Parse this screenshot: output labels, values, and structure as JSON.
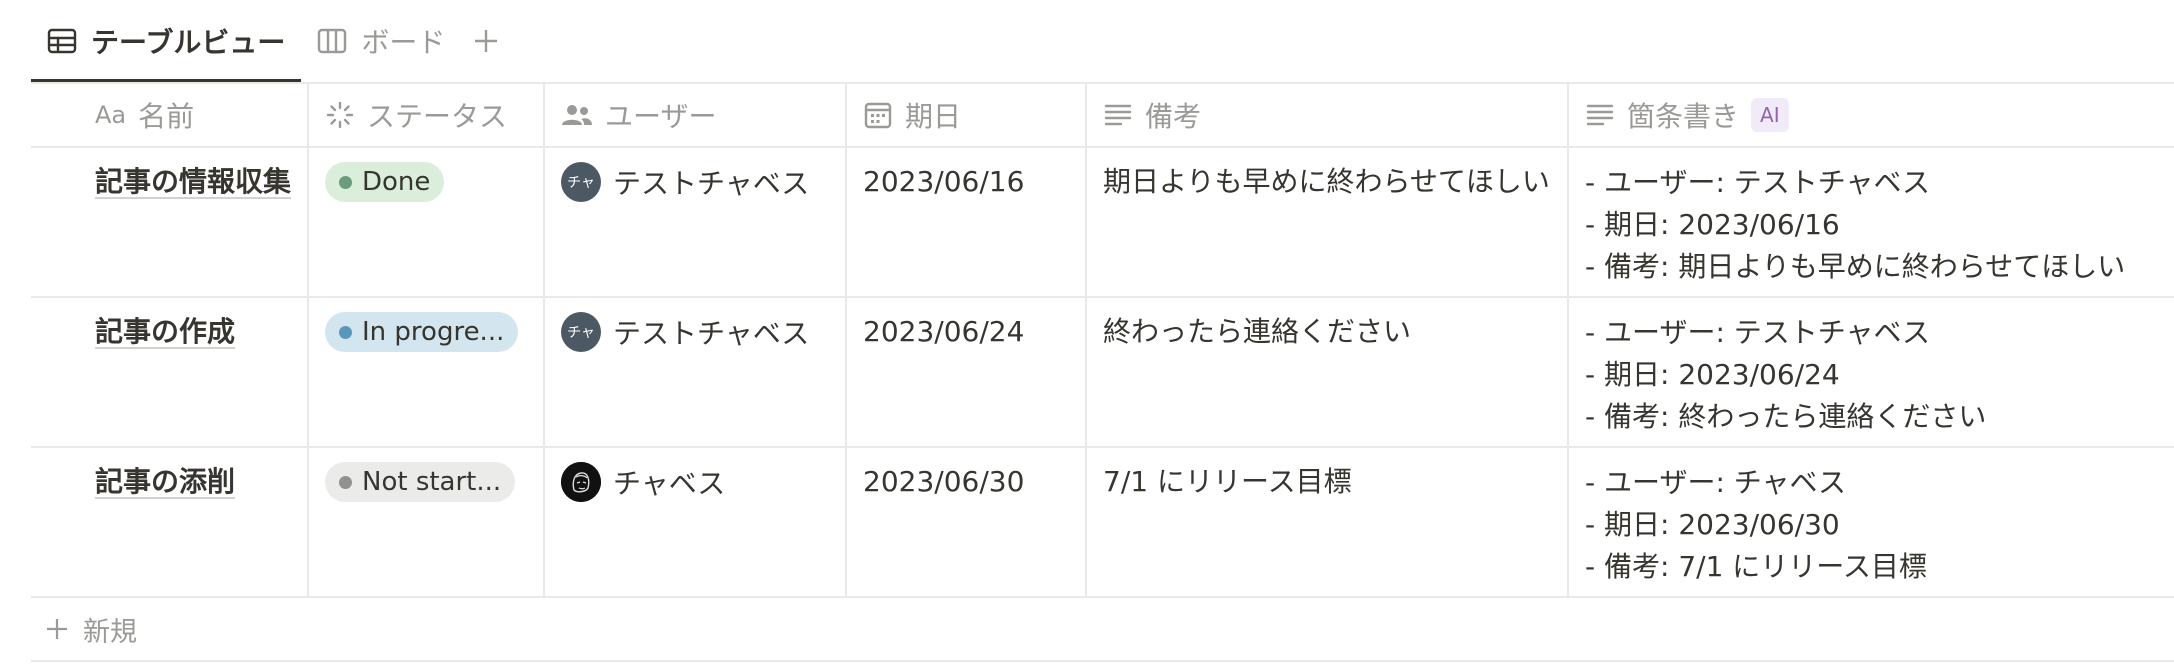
{
  "tabs": [
    {
      "label": "テーブルビュー",
      "icon": "table-icon",
      "active": true
    },
    {
      "label": "ボード",
      "icon": "board-icon",
      "active": false
    }
  ],
  "columns": {
    "name": {
      "label": "名前",
      "icon": "text-type-icon",
      "icon_text": "Aa"
    },
    "status": {
      "label": "ステータス",
      "icon": "status-icon"
    },
    "user": {
      "label": "ユーザー",
      "icon": "people-icon"
    },
    "date": {
      "label": "期日",
      "icon": "calendar-icon"
    },
    "note": {
      "label": "備考",
      "icon": "text-lines-icon"
    },
    "bullets": {
      "label": "箇条書き",
      "icon": "text-lines-icon",
      "badge": "AI"
    }
  },
  "rows": [
    {
      "name": "記事の情報収集",
      "status": {
        "label": "Done",
        "bg": "#dbeddb",
        "dot": "#6c9b7d"
      },
      "user": {
        "name": "テストチャベス",
        "avatar_text": "チャ",
        "avatar_style": "initials"
      },
      "date": "2023/06/16",
      "note": "期日よりも早めに終わらせてほしい",
      "bullets": [
        "- ユーザー: テストチャベス",
        "- 期日: 2023/06/16",
        "- 備考: 期日よりも早めに終わらせてほしい"
      ]
    },
    {
      "name": "記事の作成",
      "status": {
        "label": "In progre...",
        "bg": "#d3e5ef",
        "dot": "#5b97bd"
      },
      "user": {
        "name": "テストチャベス",
        "avatar_text": "チャ",
        "avatar_style": "initials"
      },
      "date": "2023/06/24",
      "note": "終わったら連絡ください",
      "bullets": [
        "- ユーザー: テストチャベス",
        "- 期日: 2023/06/24",
        "- 備考: 終わったら連絡ください"
      ]
    },
    {
      "name": "記事の添削",
      "status": {
        "label": "Not start...",
        "bg": "#ebebea",
        "dot": "#91918e"
      },
      "user": {
        "name": "チャベス",
        "avatar_text": "",
        "avatar_style": "photo"
      },
      "date": "2023/06/30",
      "note": "7/1 にリリース目標",
      "bullets": [
        "- ユーザー: チャベス",
        "- 期日: 2023/06/30",
        "- 備考: 7/1 にリリース目標"
      ]
    }
  ],
  "new_row_label": "新規",
  "colors": {
    "text": "#37352f",
    "muted": "#9b9a97",
    "border": "#e9e9e7"
  }
}
